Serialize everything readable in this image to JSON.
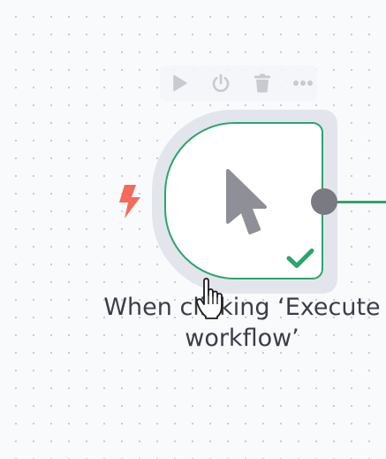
{
  "canvas": {
    "background_color": "#f9fafc",
    "dot_color": "#c7cad3"
  },
  "node_toolbar": {
    "icons": [
      "play-icon",
      "power-icon",
      "trash-icon",
      "more-dots-icon"
    ]
  },
  "node": {
    "label_line1": "When clicking ‘Execute",
    "label_line2": "workflow’",
    "main_icon": "mouse-pointer-icon",
    "status_icon": "checkmark-icon",
    "trigger_icon": "lightning-bolt-icon",
    "status": "success",
    "colors": {
      "border": "#2da46c",
      "halo": "#e3e5ec",
      "icon": "#8e8f97",
      "trigger": "#f26b5b",
      "handle": "#7a7b82",
      "toolbar_icon": "#c8cad1"
    }
  },
  "cursor": "hand-pointer-icon"
}
